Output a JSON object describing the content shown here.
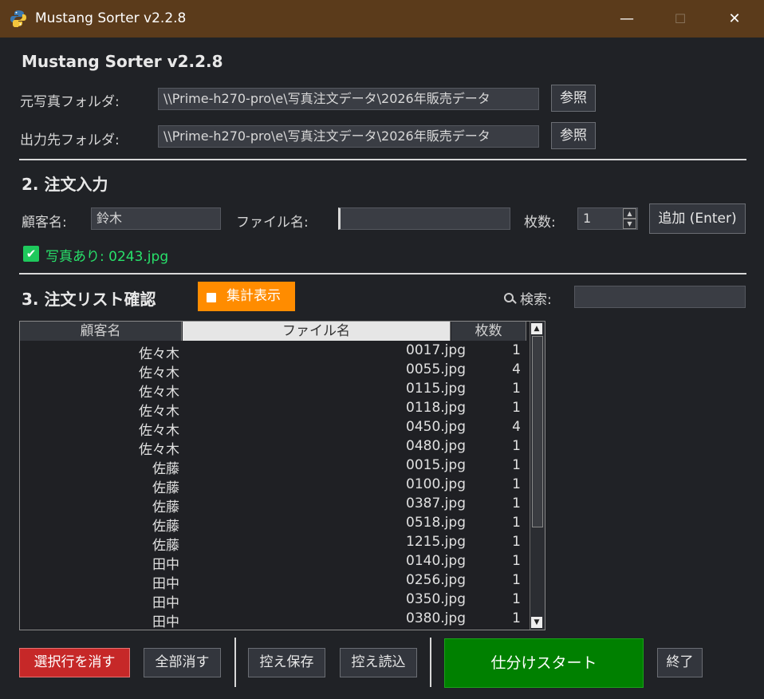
{
  "window": {
    "title": "Mustang Sorter v2.2.8",
    "minimize": "—",
    "maximize": "☐",
    "close": "✕"
  },
  "app": {
    "heading": "Mustang Sorter v2.2.8"
  },
  "folders": {
    "source_label": "元写真フォルダ:",
    "source_value": "\\\\Prime-h270-pro\\e\\写真注文データ\\2026年販売データ",
    "output_label": "出力先フォルダ:",
    "output_value": "\\\\Prime-h270-pro\\e\\写真注文データ\\2026年販売データ",
    "browse": "参照"
  },
  "order": {
    "section": "2. 注文入力",
    "customer_label": "顧客名:",
    "customer_value": "鈴木",
    "file_label": "ファイル名:",
    "file_value": "",
    "qty_label": "枚数:",
    "qty_value": "1",
    "add_button": "追加 (Enter)",
    "status_text": "写真あり: 0243.jpg"
  },
  "list": {
    "section": "3. 注文リスト確認",
    "summary_button": "集計表示",
    "search_label": "検索:",
    "search_value": "",
    "columns": [
      "顧客名",
      "ファイル名",
      "枚数"
    ],
    "rows": [
      [
        "佐々木",
        "0017.jpg",
        "1"
      ],
      [
        "佐々木",
        "0055.jpg",
        "4"
      ],
      [
        "佐々木",
        "0115.jpg",
        "1"
      ],
      [
        "佐々木",
        "0118.jpg",
        "1"
      ],
      [
        "佐々木",
        "0450.jpg",
        "4"
      ],
      [
        "佐々木",
        "0480.jpg",
        "1"
      ],
      [
        "佐藤",
        "0015.jpg",
        "1"
      ],
      [
        "佐藤",
        "0100.jpg",
        "1"
      ],
      [
        "佐藤",
        "0387.jpg",
        "1"
      ],
      [
        "佐藤",
        "0518.jpg",
        "1"
      ],
      [
        "佐藤",
        "1215.jpg",
        "1"
      ],
      [
        "田中",
        "0140.jpg",
        "1"
      ],
      [
        "田中",
        "0256.jpg",
        "1"
      ],
      [
        "田中",
        "0350.jpg",
        "1"
      ],
      [
        "田中",
        "0380.jpg",
        "1"
      ]
    ]
  },
  "actions": {
    "delete_selected": "選択行を消す",
    "delete_all": "全部消す",
    "save_backup": "控え保存",
    "load_backup": "控え読込",
    "start": "仕分けスタート",
    "exit": "終了"
  },
  "colors": {
    "accent": "#ff8c00",
    "start": "#008000",
    "danger": "#c62828",
    "ok": "#00e676"
  }
}
